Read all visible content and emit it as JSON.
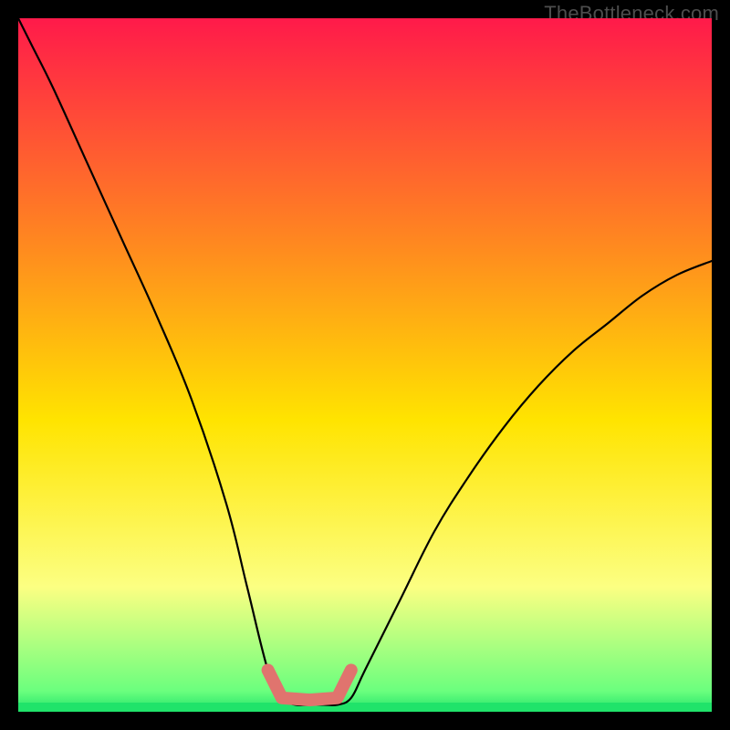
{
  "watermark": "TheBottleneck.com",
  "colors": {
    "frame": "#000000",
    "curve": "#000000",
    "highlight": "#e0746e",
    "green": "#20e36a",
    "gradient_top": "#ff1a4a",
    "gradient_mid_upper": "#ff8a1f",
    "gradient_mid": "#ffe400",
    "gradient_lower": "#fcff82",
    "gradient_bottom": "#20e36a"
  },
  "chart_data": {
    "type": "line",
    "title": "",
    "xlabel": "",
    "ylabel": "",
    "xlim": [
      0,
      100
    ],
    "ylim": [
      0,
      100
    ],
    "x": [
      0,
      2,
      5,
      10,
      15,
      20,
      25,
      30,
      33,
      36,
      38,
      40,
      42,
      44,
      46,
      48,
      50,
      55,
      60,
      65,
      70,
      75,
      80,
      85,
      90,
      95,
      100
    ],
    "values": [
      100,
      96,
      90,
      79,
      68,
      57,
      45,
      30,
      18,
      6,
      2,
      1,
      1,
      1,
      1,
      2,
      6,
      16,
      26,
      34,
      41,
      47,
      52,
      56,
      60,
      63,
      65
    ],
    "highlight_range_x": [
      36,
      48
    ],
    "highlight_y": 2
  }
}
